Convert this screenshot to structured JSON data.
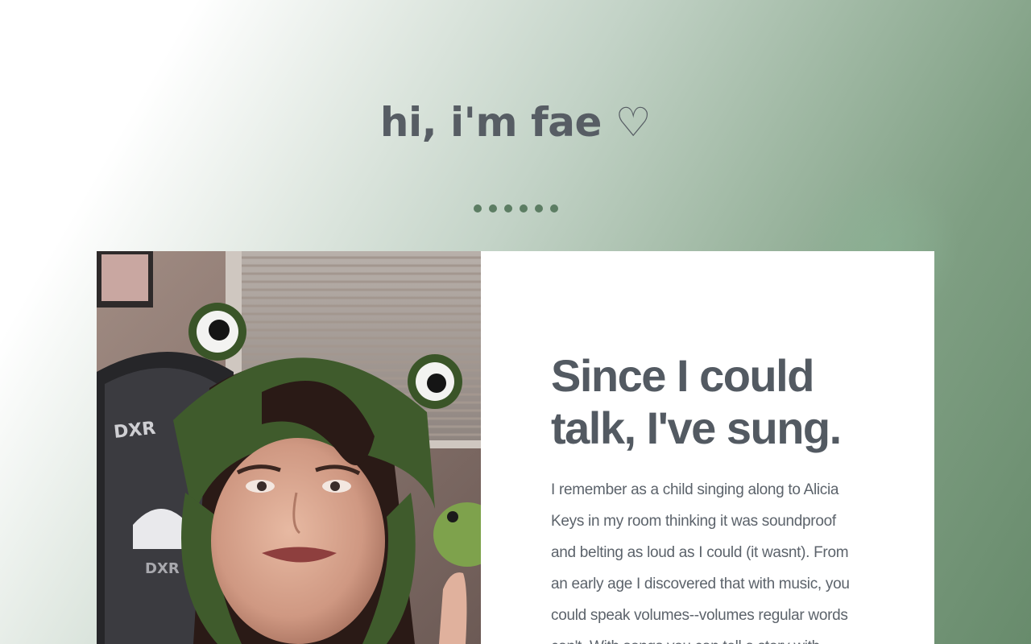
{
  "header": {
    "title": "hi, i'm fae ♡"
  },
  "divider": {
    "dot_count": 6,
    "dot_color": "#5c7d63"
  },
  "colors": {
    "heading": "#535a62",
    "body_text": "#5c636b",
    "background_green": "#688b6c"
  },
  "about": {
    "photo_alt": "fae wearing a knitted frog hat",
    "photo_text": [
      "DXR",
      "DXR"
    ],
    "heading": "Since I could talk, I've sung.",
    "body": "I remember as a child singing along to Alicia Keys in my room thinking it was soundproof and belting as loud as I could (it wasnt). From an early age I discovered that with music, you could speak volumes--volumes regular words can't. With songs you can tell a story with"
  }
}
